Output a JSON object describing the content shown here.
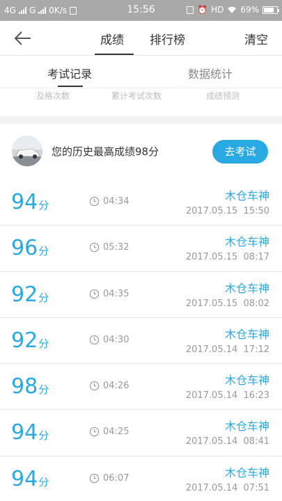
{
  "status_bar": {
    "network_left": "4G",
    "network_right": "G",
    "speed": "0K/s",
    "time": "15:56",
    "hd": "HD",
    "battery": "69%"
  },
  "header": {
    "tabs": [
      {
        "label": "成绩",
        "active": true
      },
      {
        "label": "排行榜",
        "active": false
      }
    ],
    "clear_label": "清空"
  },
  "subtabs": [
    {
      "label": "考试记录",
      "active": true
    },
    {
      "label": "数据统计",
      "active": false
    }
  ],
  "faded_labels": [
    "及格次数",
    "累计考试次数",
    "成绩预测"
  ],
  "best": {
    "text": "您的历史最高成绩98分",
    "button_label": "去考试"
  },
  "records": [
    {
      "score": "94",
      "unit": "分",
      "duration": "04:34",
      "name": "木仓车神",
      "date": "2017.05.15  15:50"
    },
    {
      "score": "96",
      "unit": "分",
      "duration": "05:32",
      "name": "木仓车神",
      "date": "2017.05.15  08:17"
    },
    {
      "score": "92",
      "unit": "分",
      "duration": "04:35",
      "name": "木仓车神",
      "date": "2017.05.15  08:02"
    },
    {
      "score": "92",
      "unit": "分",
      "duration": "04:30",
      "name": "木仓车神",
      "date": "2017.05.14  17:12"
    },
    {
      "score": "98",
      "unit": "分",
      "duration": "04:26",
      "name": "木仓车神",
      "date": "2017.05.14  16:23"
    },
    {
      "score": "94",
      "unit": "分",
      "duration": "04:25",
      "name": "木仓车神",
      "date": "2017.05.14  08:41"
    },
    {
      "score": "94",
      "unit": "分",
      "duration": "06:07",
      "name": "木仓车神",
      "date": "2017.05.14  07:51"
    }
  ],
  "colors": {
    "accent": "#29a9e1",
    "status_bar": "#a9a9a9"
  },
  "icons": {
    "back": "arrow-left-icon",
    "clock": "clock-icon"
  }
}
